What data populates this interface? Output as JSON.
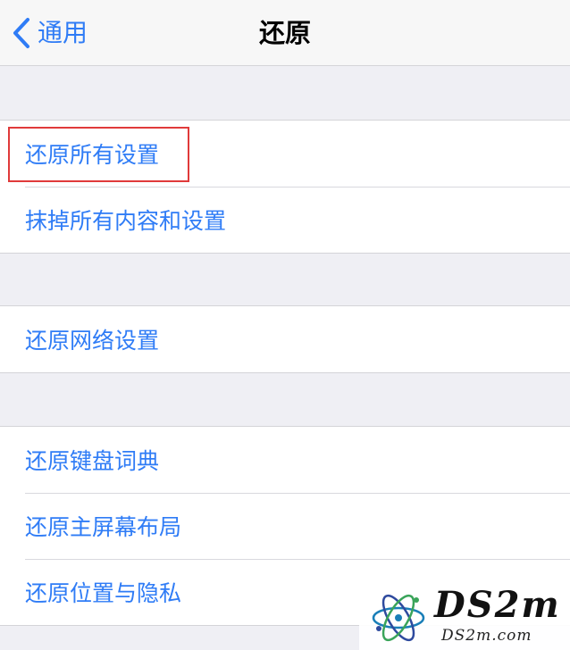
{
  "nav": {
    "back_label": "通用",
    "title": "还原"
  },
  "groups": [
    {
      "items": [
        {
          "label": "还原所有设置"
        },
        {
          "label": "抹掉所有内容和设置"
        }
      ]
    },
    {
      "items": [
        {
          "label": "还原网络设置"
        }
      ]
    },
    {
      "items": [
        {
          "label": "还原键盘词典"
        },
        {
          "label": "还原主屏幕布局"
        },
        {
          "label": "还原位置与隐私"
        }
      ]
    }
  ],
  "watermark": {
    "brand": "DS2m",
    "domain": "DS2m.com"
  },
  "colors": {
    "accent": "#2f7cf6",
    "highlight": "#e03a3a",
    "background": "#efeff4"
  },
  "icons": {
    "back": "chevron-left-icon",
    "watermark_logo": "atom-logo-icon"
  }
}
